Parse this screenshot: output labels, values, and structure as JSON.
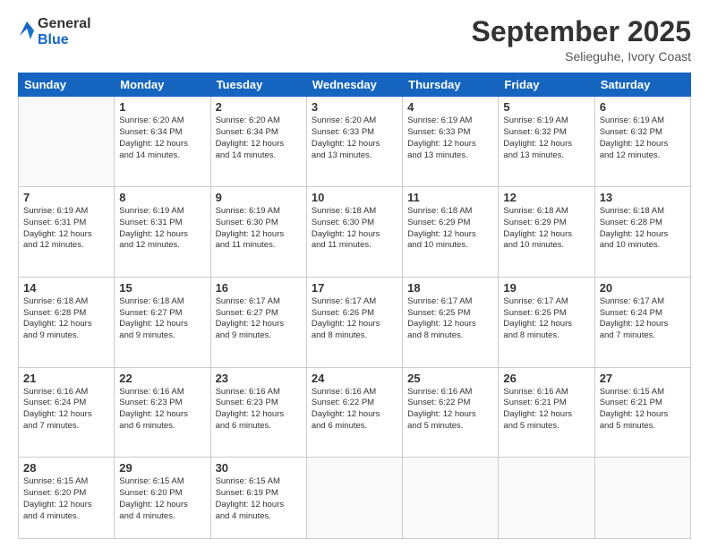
{
  "logo": {
    "general": "General",
    "blue": "Blue"
  },
  "header": {
    "month": "September 2025",
    "location": "Selieguhe, Ivory Coast"
  },
  "weekdays": [
    "Sunday",
    "Monday",
    "Tuesday",
    "Wednesday",
    "Thursday",
    "Friday",
    "Saturday"
  ],
  "weeks": [
    [
      {
        "day": "",
        "info": ""
      },
      {
        "day": "1",
        "info": "Sunrise: 6:20 AM\nSunset: 6:34 PM\nDaylight: 12 hours\nand 14 minutes."
      },
      {
        "day": "2",
        "info": "Sunrise: 6:20 AM\nSunset: 6:34 PM\nDaylight: 12 hours\nand 14 minutes."
      },
      {
        "day": "3",
        "info": "Sunrise: 6:20 AM\nSunset: 6:33 PM\nDaylight: 12 hours\nand 13 minutes."
      },
      {
        "day": "4",
        "info": "Sunrise: 6:19 AM\nSunset: 6:33 PM\nDaylight: 12 hours\nand 13 minutes."
      },
      {
        "day": "5",
        "info": "Sunrise: 6:19 AM\nSunset: 6:32 PM\nDaylight: 12 hours\nand 13 minutes."
      },
      {
        "day": "6",
        "info": "Sunrise: 6:19 AM\nSunset: 6:32 PM\nDaylight: 12 hours\nand 12 minutes."
      }
    ],
    [
      {
        "day": "7",
        "info": "Sunrise: 6:19 AM\nSunset: 6:31 PM\nDaylight: 12 hours\nand 12 minutes."
      },
      {
        "day": "8",
        "info": "Sunrise: 6:19 AM\nSunset: 6:31 PM\nDaylight: 12 hours\nand 12 minutes."
      },
      {
        "day": "9",
        "info": "Sunrise: 6:19 AM\nSunset: 6:30 PM\nDaylight: 12 hours\nand 11 minutes."
      },
      {
        "day": "10",
        "info": "Sunrise: 6:18 AM\nSunset: 6:30 PM\nDaylight: 12 hours\nand 11 minutes."
      },
      {
        "day": "11",
        "info": "Sunrise: 6:18 AM\nSunset: 6:29 PM\nDaylight: 12 hours\nand 10 minutes."
      },
      {
        "day": "12",
        "info": "Sunrise: 6:18 AM\nSunset: 6:29 PM\nDaylight: 12 hours\nand 10 minutes."
      },
      {
        "day": "13",
        "info": "Sunrise: 6:18 AM\nSunset: 6:28 PM\nDaylight: 12 hours\nand 10 minutes."
      }
    ],
    [
      {
        "day": "14",
        "info": "Sunrise: 6:18 AM\nSunset: 6:28 PM\nDaylight: 12 hours\nand 9 minutes."
      },
      {
        "day": "15",
        "info": "Sunrise: 6:18 AM\nSunset: 6:27 PM\nDaylight: 12 hours\nand 9 minutes."
      },
      {
        "day": "16",
        "info": "Sunrise: 6:17 AM\nSunset: 6:27 PM\nDaylight: 12 hours\nand 9 minutes."
      },
      {
        "day": "17",
        "info": "Sunrise: 6:17 AM\nSunset: 6:26 PM\nDaylight: 12 hours\nand 8 minutes."
      },
      {
        "day": "18",
        "info": "Sunrise: 6:17 AM\nSunset: 6:25 PM\nDaylight: 12 hours\nand 8 minutes."
      },
      {
        "day": "19",
        "info": "Sunrise: 6:17 AM\nSunset: 6:25 PM\nDaylight: 12 hours\nand 8 minutes."
      },
      {
        "day": "20",
        "info": "Sunrise: 6:17 AM\nSunset: 6:24 PM\nDaylight: 12 hours\nand 7 minutes."
      }
    ],
    [
      {
        "day": "21",
        "info": "Sunrise: 6:16 AM\nSunset: 6:24 PM\nDaylight: 12 hours\nand 7 minutes."
      },
      {
        "day": "22",
        "info": "Sunrise: 6:16 AM\nSunset: 6:23 PM\nDaylight: 12 hours\nand 6 minutes."
      },
      {
        "day": "23",
        "info": "Sunrise: 6:16 AM\nSunset: 6:23 PM\nDaylight: 12 hours\nand 6 minutes."
      },
      {
        "day": "24",
        "info": "Sunrise: 6:16 AM\nSunset: 6:22 PM\nDaylight: 12 hours\nand 6 minutes."
      },
      {
        "day": "25",
        "info": "Sunrise: 6:16 AM\nSunset: 6:22 PM\nDaylight: 12 hours\nand 5 minutes."
      },
      {
        "day": "26",
        "info": "Sunrise: 6:16 AM\nSunset: 6:21 PM\nDaylight: 12 hours\nand 5 minutes."
      },
      {
        "day": "27",
        "info": "Sunrise: 6:15 AM\nSunset: 6:21 PM\nDaylight: 12 hours\nand 5 minutes."
      }
    ],
    [
      {
        "day": "28",
        "info": "Sunrise: 6:15 AM\nSunset: 6:20 PM\nDaylight: 12 hours\nand 4 minutes."
      },
      {
        "day": "29",
        "info": "Sunrise: 6:15 AM\nSunset: 6:20 PM\nDaylight: 12 hours\nand 4 minutes."
      },
      {
        "day": "30",
        "info": "Sunrise: 6:15 AM\nSunset: 6:19 PM\nDaylight: 12 hours\nand 4 minutes."
      },
      {
        "day": "",
        "info": ""
      },
      {
        "day": "",
        "info": ""
      },
      {
        "day": "",
        "info": ""
      },
      {
        "day": "",
        "info": ""
      }
    ]
  ]
}
